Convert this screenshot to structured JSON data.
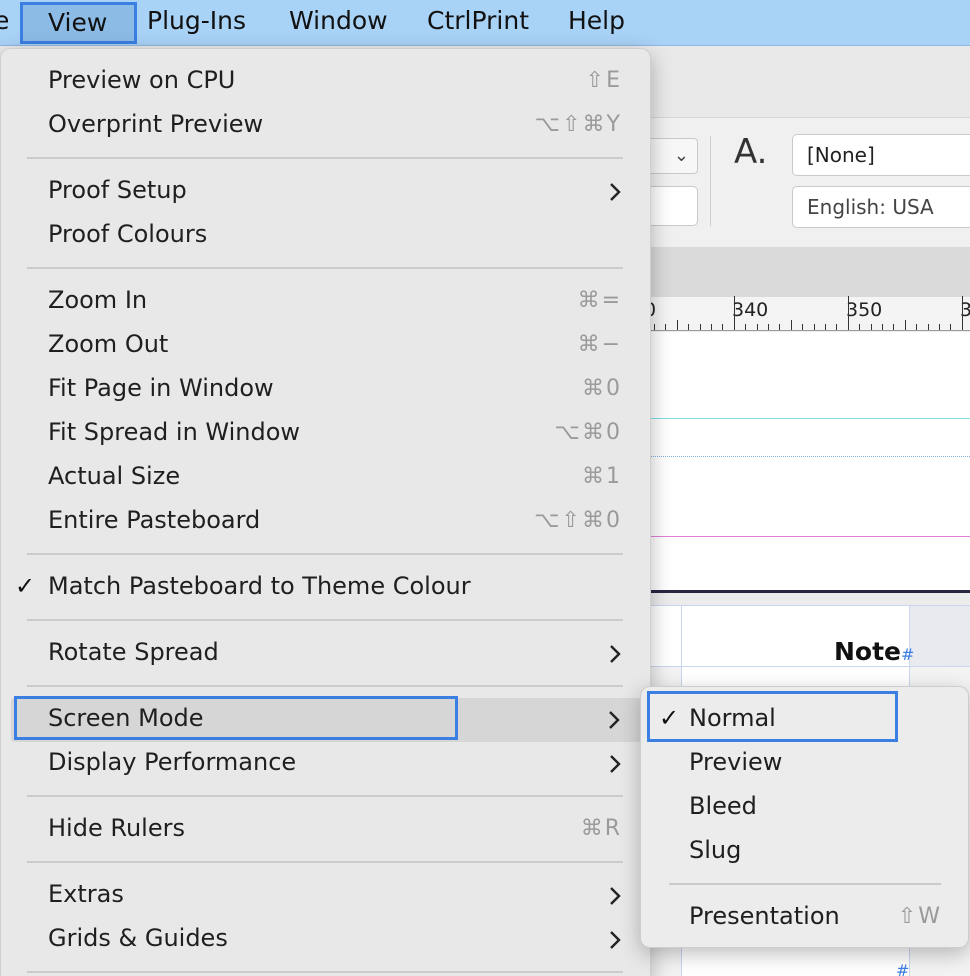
{
  "menubar": {
    "items": [
      {
        "label": "e"
      },
      {
        "label": "View"
      },
      {
        "label": "Plug-Ins"
      },
      {
        "label": "Window"
      },
      {
        "label": "CtrlPrint"
      },
      {
        "label": "Help"
      }
    ]
  },
  "view_menu": {
    "items": [
      {
        "label": "Preview on CPU",
        "shortcut": "⇧E"
      },
      {
        "label": "Overprint Preview",
        "shortcut": "⌥⇧⌘Y"
      },
      {
        "label": "Proof Setup"
      },
      {
        "label": "Proof Colours"
      },
      {
        "label": "Zoom In",
        "shortcut": "⌘="
      },
      {
        "label": "Zoom Out",
        "shortcut": "⌘−"
      },
      {
        "label": "Fit Page in Window",
        "shortcut": "⌘0"
      },
      {
        "label": "Fit Spread in Window",
        "shortcut": "⌥⌘0"
      },
      {
        "label": "Actual Size",
        "shortcut": "⌘1"
      },
      {
        "label": "Entire Pasteboard",
        "shortcut": "⌥⇧⌘0"
      },
      {
        "label": "Match Pasteboard to Theme Colour",
        "checked": "✓"
      },
      {
        "label": "Rotate Spread"
      },
      {
        "label": "Screen Mode"
      },
      {
        "label": "Display Performance"
      },
      {
        "label": "Hide Rulers",
        "shortcut": "⌘R"
      },
      {
        "label": "Extras"
      },
      {
        "label": "Grids & Guides"
      }
    ]
  },
  "screen_mode_submenu": {
    "items": [
      {
        "label": "Normal",
        "checked": "✓"
      },
      {
        "label": "Preview"
      },
      {
        "label": "Bleed"
      },
      {
        "label": "Slug"
      },
      {
        "label": "Presentation",
        "shortcut": "⇧W"
      }
    ]
  },
  "app": {
    "char_style_icon": "A.",
    "style_field": "[None]",
    "language_field": "English: USA",
    "ruler_labels": [
      "0",
      "340",
      "350",
      "3"
    ],
    "cell_text": "Note",
    "hash_mark": "#",
    "hash_mark_2": "#"
  },
  "colors": {
    "menubar_bg": "#a9d2f7",
    "focus_outline": "#3b7fe3",
    "guide_cyan": "#7fe0e8",
    "guide_magenta": "#e07fd6"
  }
}
